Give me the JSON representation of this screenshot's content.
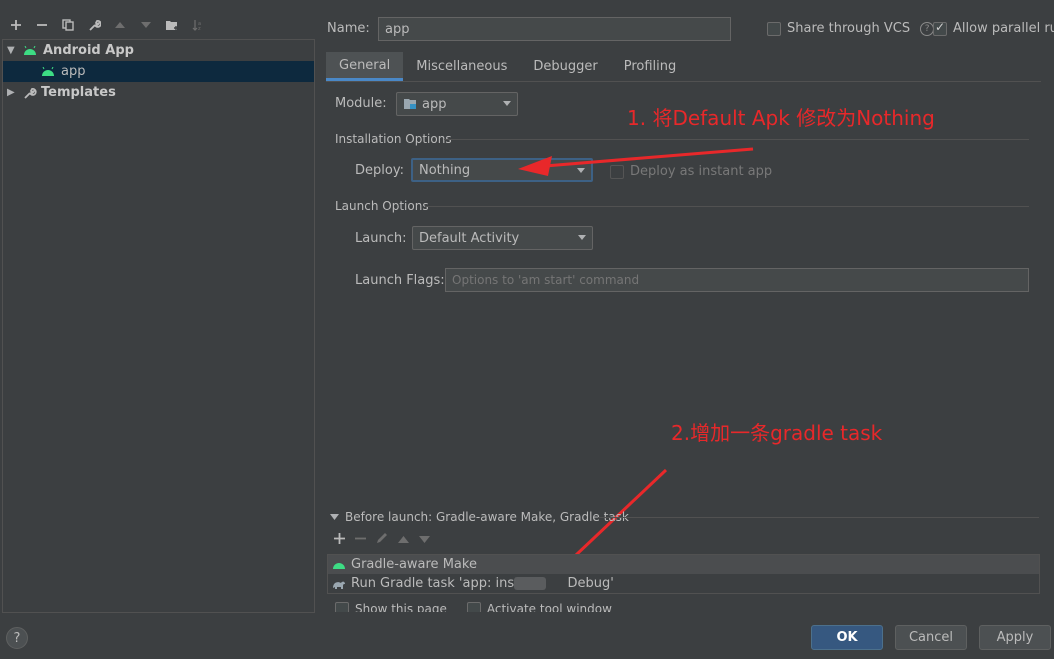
{
  "left_panel": {
    "toolbar_icons": [
      "add-icon",
      "remove-icon",
      "copy-icon",
      "wrench-icon",
      "move-up-icon",
      "move-down-icon",
      "folder-add-icon",
      "sort-icon"
    ],
    "tree": [
      {
        "label": "Android App",
        "expanded": true
      },
      {
        "label": "app",
        "selected": true
      },
      {
        "label": "Templates",
        "expanded": false
      }
    ]
  },
  "header": {
    "name_label": "Name:",
    "name_value": "app",
    "share_vcs": "Share through VCS",
    "share_vcs_checked": false,
    "allow_parallel": "Allow parallel run",
    "allow_parallel_checked": true
  },
  "tabs": [
    "General",
    "Miscellaneous",
    "Debugger",
    "Profiling"
  ],
  "general": {
    "module_label": "Module:",
    "module_value": "app",
    "installation_options": "Installation Options",
    "deploy_label": "Deploy:",
    "deploy_value": "Nothing",
    "deploy_instant": "Deploy as instant app",
    "launch_options": "Launch Options",
    "launch_label": "Launch:",
    "launch_value": "Default Activity",
    "launch_flags_label": "Launch Flags:",
    "launch_flags_placeholder": "Options to 'am start' command"
  },
  "annotations": {
    "step1": "1. 将Default Apk 修改为Nothing",
    "step2": "2.增加一条gradle task"
  },
  "before_launch": {
    "title": "Before launch: Gradle-aware Make, Gradle task",
    "items": [
      "Gradle-aware Make",
      "Run Gradle task 'app: install        Debug'"
    ],
    "show_page": "Show this page",
    "activate_window": "Activate tool window"
  },
  "footer": {
    "help": "?",
    "ok": "OK",
    "cancel": "Cancel",
    "apply": "Apply"
  },
  "colors": {
    "background": "#3c3f41",
    "accent": "#4a88c7",
    "annotation": "#e8282a",
    "android": "#3ddc84"
  }
}
